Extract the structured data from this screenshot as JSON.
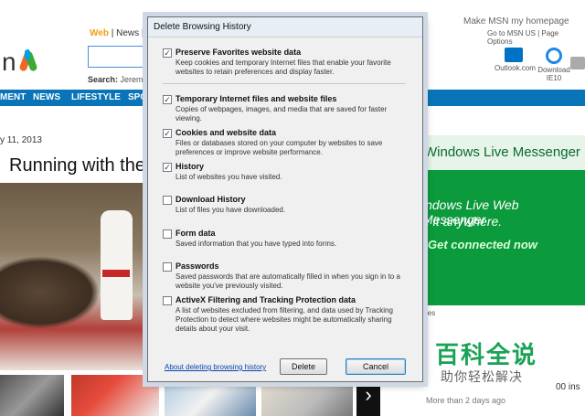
{
  "msn": {
    "tabs": [
      "Web",
      "|",
      "News",
      "|"
    ],
    "search_prefix": "Search:",
    "search_suggestion": "Jerem",
    "make_msn": "Make MSN my homepage",
    "links": "Go to MSN US | Page Options",
    "outlook": "Outlook.com",
    "ie_line1": "Download",
    "ie_line2": "IE10",
    "nav": [
      "MENT",
      "NEWS",
      "LIFESTYLE",
      "SPO"
    ],
    "date": "y 11, 2013",
    "headline": "Running with the",
    "ad_title": "Windows Live Messenger",
    "ad_line1": "indows Live Web Messenger",
    "ad_line2": "e it anywhere.",
    "ad_cta": "Get connected now",
    "ad_choices": "ices",
    "more_than": "More than 2 days ago",
    "right_num": "00 ins",
    "arrow": "›"
  },
  "watermark": {
    "title": "百科全说",
    "subtitle": "助你轻松解决"
  },
  "dialog": {
    "title": "Delete Browsing History",
    "options": [
      {
        "label": "Preserve Favorites website data",
        "checked": true,
        "desc": "Keep cookies and temporary Internet files that enable your favorite websites to retain preferences and display faster."
      },
      {
        "label": "Temporary Internet files and website files",
        "checked": true,
        "desc": "Copies of webpages, images, and media that are saved for faster viewing."
      },
      {
        "label": "Cookies and website data",
        "checked": true,
        "desc": "Files or databases stored on your computer by websites to save preferences or improve website performance."
      },
      {
        "label": "History",
        "checked": true,
        "desc": "List of websites you have visited."
      },
      {
        "label": "Download History",
        "checked": false,
        "desc": "List of files you have downloaded."
      },
      {
        "label": "Form data",
        "checked": false,
        "desc": "Saved information that you have typed into forms."
      },
      {
        "label": "Passwords",
        "checked": false,
        "desc": "Saved passwords that are automatically filled in when you sign in to a website you've previously visited."
      },
      {
        "label": "ActiveX Filtering and Tracking Protection data",
        "checked": false,
        "desc": "A list of websites excluded from filtering, and data used by Tracking Protection to detect where websites might be automatically sharing details about your visit."
      }
    ],
    "about_link": "About deleting browsing history",
    "delete_label": "Delete",
    "cancel_label": "Cancel",
    "check_glyph": "✓"
  }
}
